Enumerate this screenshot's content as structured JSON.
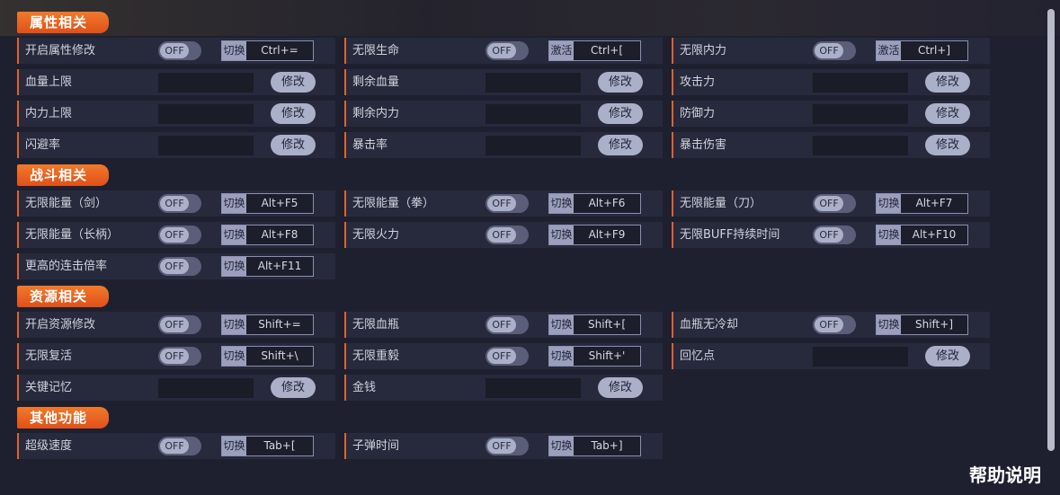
{
  "sections": [
    {
      "title": "属性相关",
      "rows": [
        [
          {
            "type": "toggle",
            "label": "开启属性修改",
            "state": "OFF",
            "mode": "切换",
            "keys": "Ctrl+="
          },
          {
            "type": "toggle",
            "label": "无限生命",
            "state": "OFF",
            "mode": "激活",
            "keys": "Ctrl+["
          },
          {
            "type": "toggle",
            "label": "无限内力",
            "state": "OFF",
            "mode": "激活",
            "keys": "Ctrl+]"
          }
        ],
        [
          {
            "type": "value",
            "label": "血量上限",
            "button": "修改"
          },
          {
            "type": "value",
            "label": "剩余血量",
            "button": "修改"
          },
          {
            "type": "value",
            "label": "攻击力",
            "button": "修改"
          }
        ],
        [
          {
            "type": "value",
            "label": "内力上限",
            "button": "修改"
          },
          {
            "type": "value",
            "label": "剩余内力",
            "button": "修改"
          },
          {
            "type": "value",
            "label": "防御力",
            "button": "修改"
          }
        ],
        [
          {
            "type": "value",
            "label": "闪避率",
            "button": "修改"
          },
          {
            "type": "value",
            "label": "暴击率",
            "button": "修改"
          },
          {
            "type": "value",
            "label": "暴击伤害",
            "button": "修改"
          }
        ]
      ]
    },
    {
      "title": "战斗相关",
      "rows": [
        [
          {
            "type": "toggle",
            "label": "无限能量（剑）",
            "state": "OFF",
            "mode": "切换",
            "keys": "Alt+F5"
          },
          {
            "type": "toggle",
            "label": "无限能量（拳）",
            "state": "OFF",
            "mode": "切换",
            "keys": "Alt+F6"
          },
          {
            "type": "toggle",
            "label": "无限能量（刀）",
            "state": "OFF",
            "mode": "切换",
            "keys": "Alt+F7"
          }
        ],
        [
          {
            "type": "toggle",
            "label": "无限能量（长柄）",
            "state": "OFF",
            "mode": "切换",
            "keys": "Alt+F8"
          },
          {
            "type": "toggle",
            "label": "无限火力",
            "state": "OFF",
            "mode": "切换",
            "keys": "Alt+F9"
          },
          {
            "type": "toggle",
            "label": "无限BUFF持续时间",
            "state": "OFF",
            "mode": "切换",
            "keys": "Alt+F10"
          }
        ],
        [
          {
            "type": "toggle",
            "label": "更高的连击倍率",
            "state": "OFF",
            "mode": "切换",
            "keys": "Alt+F11"
          }
        ]
      ]
    },
    {
      "title": "资源相关",
      "rows": [
        [
          {
            "type": "toggle",
            "label": "开启资源修改",
            "state": "OFF",
            "mode": "切换",
            "keys": "Shift+="
          },
          {
            "type": "toggle",
            "label": "无限血瓶",
            "state": "OFF",
            "mode": "切换",
            "keys": "Shift+["
          },
          {
            "type": "toggle",
            "label": "血瓶无冷却",
            "state": "OFF",
            "mode": "切换",
            "keys": "Shift+]"
          }
        ],
        [
          {
            "type": "toggle",
            "label": "无限复活",
            "state": "OFF",
            "mode": "切换",
            "keys": "Shift+\\"
          },
          {
            "type": "toggle",
            "label": "无限重毅",
            "state": "OFF",
            "mode": "切换",
            "keys": "Shift+'"
          },
          {
            "type": "value",
            "label": "回忆点",
            "button": "修改"
          }
        ],
        [
          {
            "type": "value",
            "label": "关键记忆",
            "button": "修改"
          },
          {
            "type": "value",
            "label": "金钱",
            "button": "修改"
          }
        ]
      ]
    },
    {
      "title": "其他功能",
      "rows": [
        [
          {
            "type": "toggle",
            "label": "超级速度",
            "state": "OFF",
            "mode": "切换",
            "keys": "Tab+["
          },
          {
            "type": "toggle",
            "label": "子弹时间",
            "state": "OFF",
            "mode": "切换",
            "keys": "Tab+]"
          }
        ]
      ]
    }
  ],
  "help_label": "帮助说明",
  "colors": {
    "accent": "#e0622a",
    "panel": "#272a3c",
    "background": "#1e2030"
  }
}
